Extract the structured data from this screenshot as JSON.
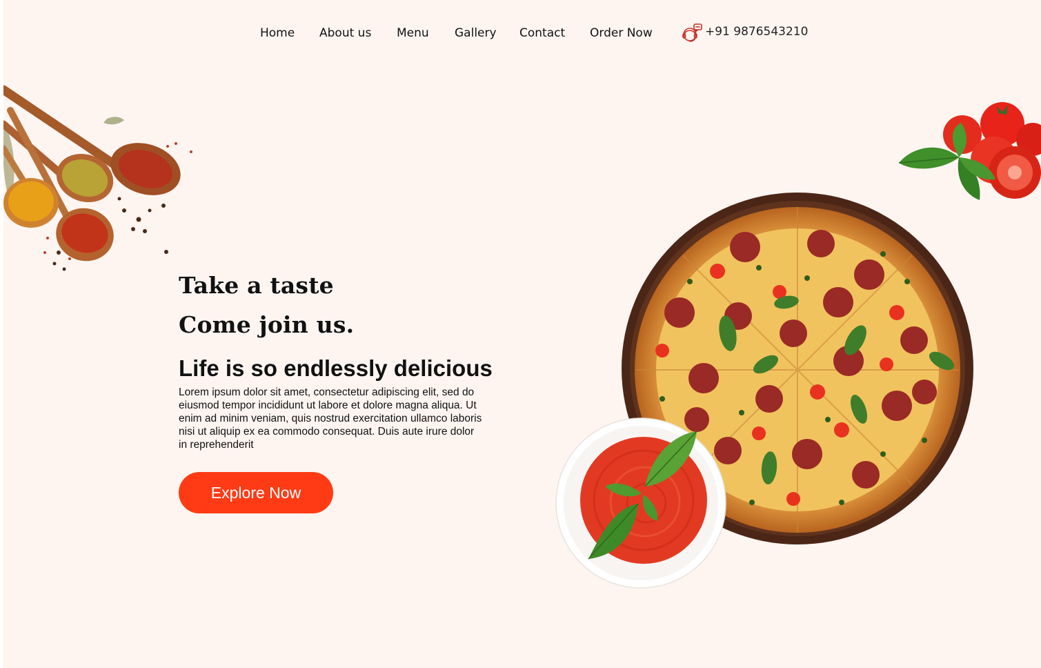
{
  "nav": {
    "items": [
      {
        "label": "Home"
      },
      {
        "label": "About us"
      },
      {
        "label": "Menu"
      },
      {
        "label": "Gallery"
      },
      {
        "label": "Contact"
      },
      {
        "label": "Order Now"
      }
    ],
    "phone": "+91 9876543210",
    "phone_icon": "phone-support-icon"
  },
  "hero": {
    "line1": "Take a taste",
    "line2": "Come join us.",
    "subtitle": "Life is so endlessly delicious",
    "body": "Lorem ipsum dolor sit amet, consectetur adipiscing elit, sed do eiusmod tempor incididunt ut labore et dolore magna aliqua. Ut enim ad minim veniam, quis nostrud exercitation ullamco laboris nisi ut aliquip ex ea commodo consequat. Duis aute irure dolor in reprehenderit",
    "cta": "Explore Now"
  },
  "colors": {
    "background": "#fef5f1",
    "accent": "#ff3b15",
    "text": "#111111"
  },
  "images": {
    "spices": "spice-spoons-image",
    "tomatoes": "tomatoes-basil-image",
    "pizza": "pizza-image",
    "sauce": "tomato-sauce-bowl-image"
  }
}
